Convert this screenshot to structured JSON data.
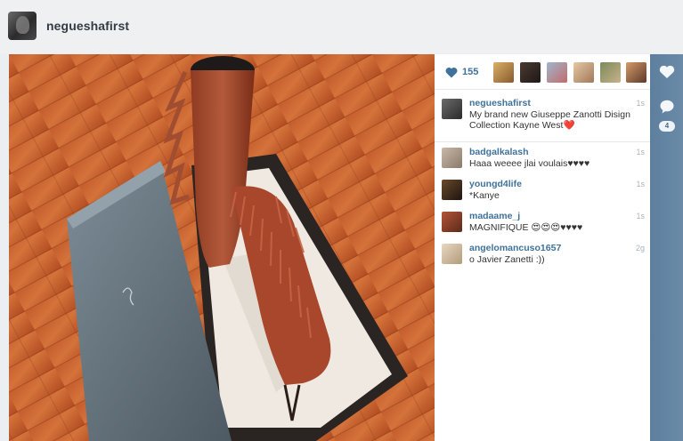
{
  "header": {
    "username": "negueshafirst"
  },
  "likes": {
    "count": "155",
    "avatars": [
      "liker-1",
      "liker-2",
      "liker-3",
      "liker-4",
      "liker-5",
      "liker-6"
    ]
  },
  "caption": {
    "username": "negueshafirst",
    "text": "My brand new Giuseppe Zanotti Disign Collection Kayne West❤️",
    "time": "1s"
  },
  "comments": [
    {
      "username": "badgalkalash",
      "text": "Haaa weeee jlai voulais♥♥♥♥",
      "time": "1s"
    },
    {
      "username": "youngd4life",
      "text": "*Kanye",
      "time": "1s"
    },
    {
      "username": "madaame_j",
      "text": "MAGNIFIQUE 😍😍😍♥♥♥♥",
      "time": "1s"
    },
    {
      "username": "angelomancuso1657",
      "text": "o Javier Zanetti :))",
      "time": "2g"
    }
  ],
  "actions": {
    "comment_count": "4"
  },
  "icons": {
    "like": "heart-icon",
    "comment": "comment-bubble-icon"
  },
  "colors": {
    "username_blue": "#3f729b",
    "rail_blue": "#6788a5"
  }
}
